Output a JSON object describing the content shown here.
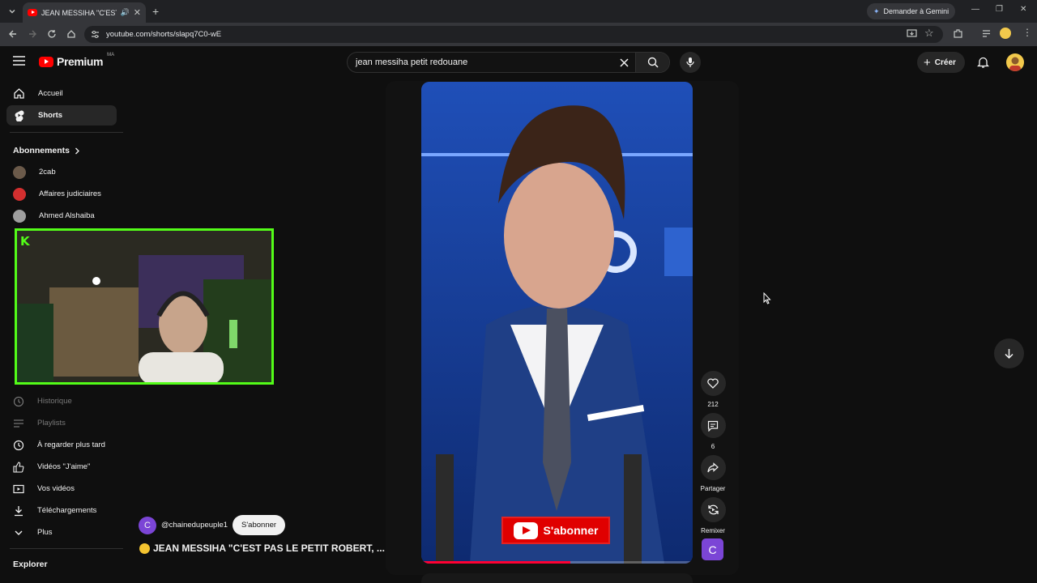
{
  "browser": {
    "tab_title": "JEAN MESSIHA \"C'EST P",
    "gemini_label": "Demander à Gemini",
    "url": "youtube.com/shorts/slapq7C0-wE"
  },
  "header": {
    "logo_text": "Premium",
    "logo_region": "MA",
    "search_value": "jean messiha petit redouane",
    "create_label": "Créer"
  },
  "sidebar": {
    "home": "Accueil",
    "shorts": "Shorts",
    "subscriptions_title": "Abonnements",
    "subscriptions": [
      "2cab",
      "Affaires judiciaires",
      "Ahmed Alshaiba"
    ],
    "you_items": [
      "Historique",
      "Playlists",
      "À regarder plus tard",
      "Vidéos \"J'aime\"",
      "Vos vidéos",
      "Téléchargements",
      "Plus"
    ],
    "explore_title": "Explorer"
  },
  "short": {
    "progress": 0.55,
    "overlay_subscribe": "S'abonner",
    "likes": "212",
    "comments": "6",
    "share": "Partager",
    "remix": "Remixer",
    "channel_initial": "C",
    "channel_handle": "@chainedupeuple1",
    "subscribe_label": "S'abonner",
    "title": "JEAN MESSIHA \"C'EST PAS LE PETIT ROBERT, ..."
  },
  "colors": {
    "brand_red": "#ff0000",
    "kick_green": "#53fc18",
    "channel_purple": "#7b45d6"
  }
}
